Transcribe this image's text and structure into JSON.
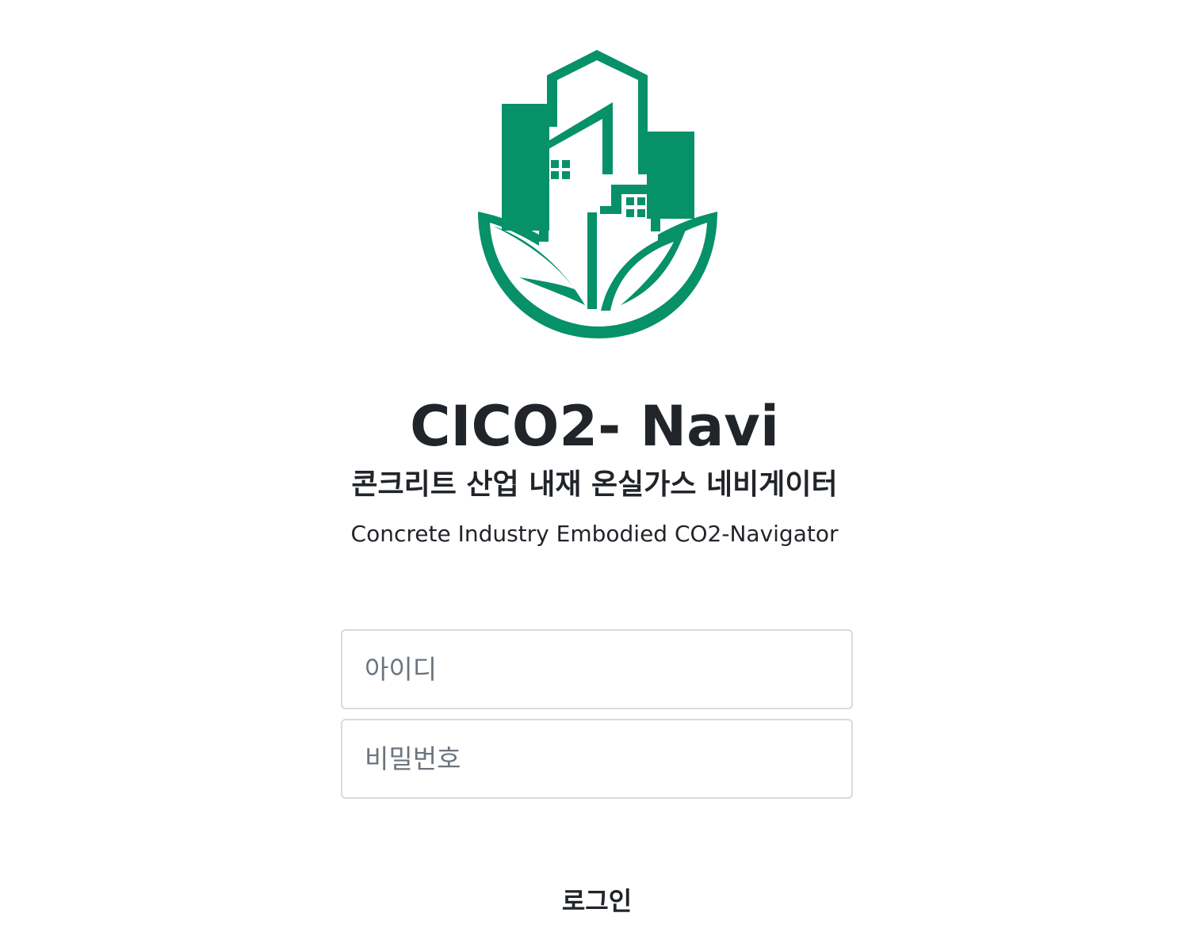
{
  "brand": {
    "title": "CICO2- Navi",
    "subtitle_ko": "콘크리트 산업 내재 온실가스 네비게이터",
    "subtitle_en": "Concrete Industry Embodied CO2-Navigator",
    "logo_icon": "green-building-leaf-logo",
    "brand_color": "#069168"
  },
  "login_form": {
    "id_field": {
      "placeholder": "아이디",
      "value": ""
    },
    "password_field": {
      "placeholder": "비밀번호",
      "value": ""
    },
    "submit_label": "로그인"
  }
}
